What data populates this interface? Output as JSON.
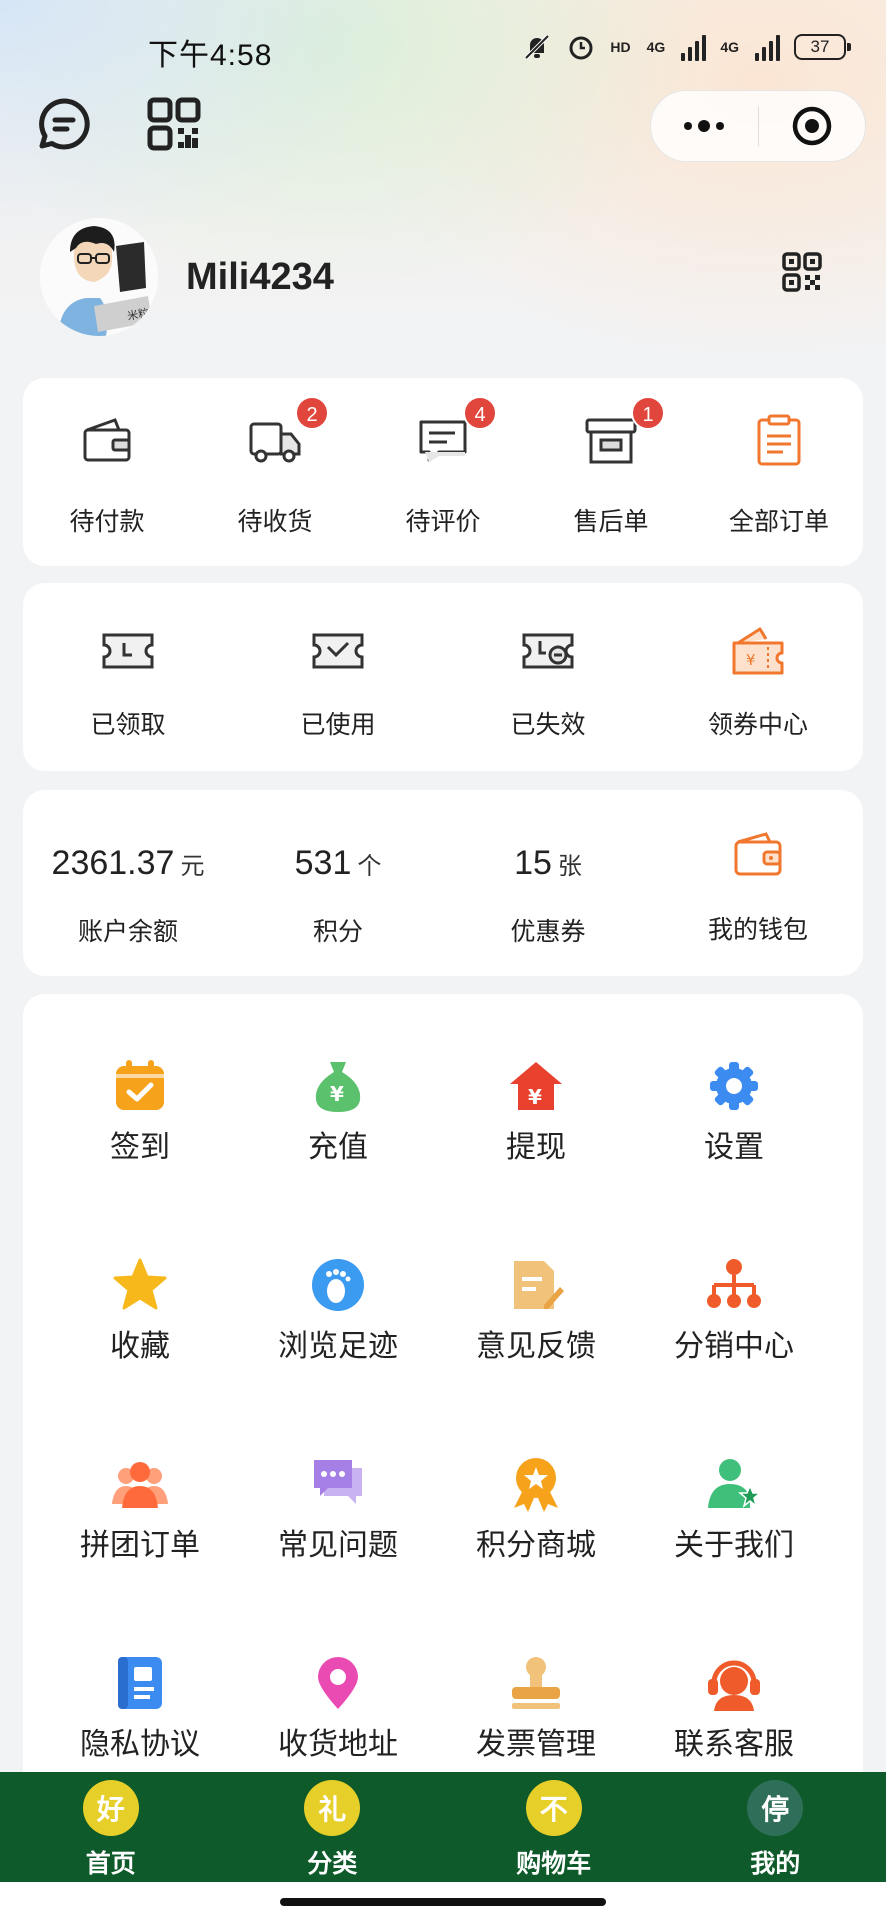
{
  "status": {
    "time": "下午4:58",
    "net1": "4G",
    "net2": "4G",
    "hd": "HD",
    "battery": "37"
  },
  "profile": {
    "username": "Mili4234",
    "avatar_caption": "米粒"
  },
  "orders": [
    {
      "label": "待付款",
      "icon": "wallet-icon",
      "badge": ""
    },
    {
      "label": "待收货",
      "icon": "truck-icon",
      "badge": "2"
    },
    {
      "label": "待评价",
      "icon": "comment-icon",
      "badge": "4"
    },
    {
      "label": "售后单",
      "icon": "box-icon",
      "badge": "1"
    },
    {
      "label": "全部订单",
      "icon": "clipboard-icon",
      "badge": ""
    }
  ],
  "coupons": [
    {
      "label": "已领取",
      "icon": "ticket-icon"
    },
    {
      "label": "已使用",
      "icon": "ticket-check-icon"
    },
    {
      "label": "已失效",
      "icon": "ticket-expired-icon"
    },
    {
      "label": "领券中心",
      "icon": "coupon-center-icon"
    }
  ],
  "assets": [
    {
      "value": "2361.37",
      "unit": "元",
      "label": "账户余额"
    },
    {
      "value": "531",
      "unit": "个",
      "label": "积分"
    },
    {
      "value": "15",
      "unit": "张",
      "label": "优惠券"
    }
  ],
  "wallet": {
    "label": "我的钱包",
    "icon": "wallet-orange-icon"
  },
  "services": [
    {
      "label": "签到",
      "icon": "calendar-check-icon",
      "color": "#f7a21b"
    },
    {
      "label": "充值",
      "icon": "money-bag-icon",
      "color": "#5cc16d"
    },
    {
      "label": "提现",
      "icon": "house-yuan-icon",
      "color": "#e8412d"
    },
    {
      "label": "设置",
      "icon": "gear-icon",
      "color": "#3b8bf0"
    },
    {
      "label": "收藏",
      "icon": "star-icon",
      "color": "#f7b81b"
    },
    {
      "label": "浏览足迹",
      "icon": "footprint-icon",
      "color": "#3b9bf0"
    },
    {
      "label": "意见反馈",
      "icon": "feedback-icon",
      "color": "#f0b85a"
    },
    {
      "label": "分销中心",
      "icon": "org-chart-icon",
      "color": "#ef5b2a"
    },
    {
      "label": "拼团订单",
      "icon": "group-icon",
      "color": "#ff7a45"
    },
    {
      "label": "常见问题",
      "icon": "chat-bubble-icon",
      "color": "#a57fe6"
    },
    {
      "label": "积分商城",
      "icon": "medal-icon",
      "color": "#f7a21b"
    },
    {
      "label": "关于我们",
      "icon": "user-star-icon",
      "color": "#3ec07a"
    },
    {
      "label": "隐私协议",
      "icon": "document-icon",
      "color": "#3b8bf0"
    },
    {
      "label": "收货地址",
      "icon": "location-pin-icon",
      "color": "#ea4bb3"
    },
    {
      "label": "发票管理",
      "icon": "stamp-icon",
      "color": "#f0b85a"
    },
    {
      "label": "联系客服",
      "icon": "headset-icon",
      "color": "#ef5b2a"
    }
  ],
  "tabs": [
    {
      "label": "首页",
      "glyph": "好"
    },
    {
      "label": "分类",
      "glyph": "礼"
    },
    {
      "label": "购物车",
      "glyph": "不"
    },
    {
      "label": "我的",
      "glyph": "停"
    }
  ]
}
